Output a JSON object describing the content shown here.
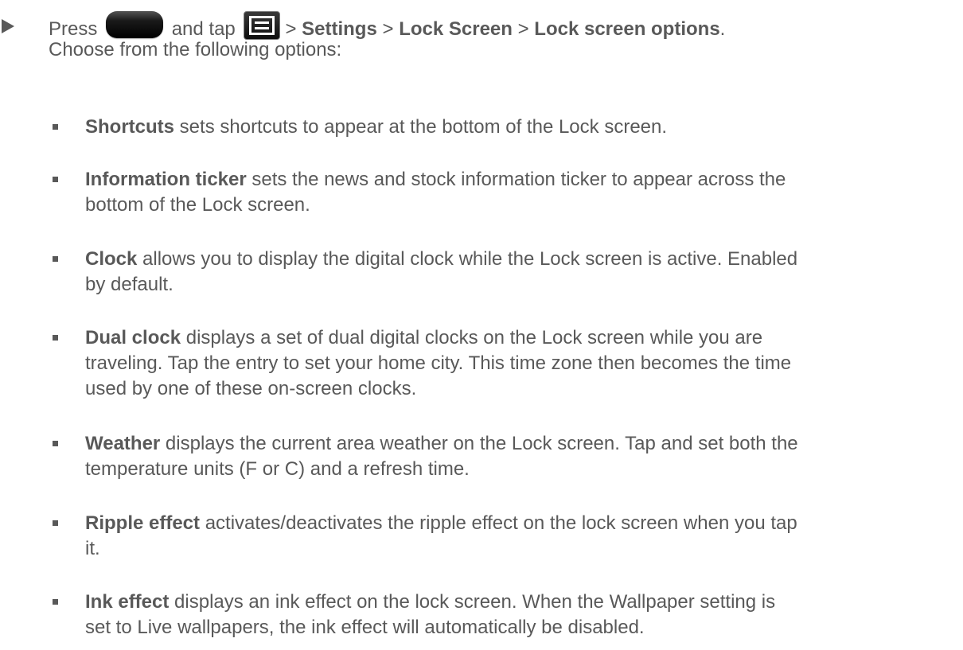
{
  "step": {
    "press_label": "Press",
    "and_tap_label": "and tap",
    "sep1": ">",
    "settings": "Settings",
    "sep2": ">",
    "lock_screen": "Lock Screen",
    "sep3": ">",
    "lock_screen_options": "Lock screen options",
    "period": ".",
    "subtext": "Choose from the following options:"
  },
  "icons": {
    "step_marker": "right-pointer-icon",
    "home_button": "home-button-icon",
    "menu_button": "menu-button-icon",
    "bullet": "square-bullet-icon"
  },
  "options": [
    {
      "term": "Shortcuts",
      "line1": " sets shortcuts to appear at the bottom of the Lock screen.",
      "line2": ""
    },
    {
      "term": "Information ticker",
      "line1": " sets the news and stock information ticker to appear across the",
      "line2": "bottom of the Lock screen."
    },
    {
      "term": "Clock",
      "line1": " allows you to display the digital clock while the Lock screen is active. Enabled",
      "line2": "by default."
    },
    {
      "term": "Dual clock",
      "line1": " displays a set of dual digital clocks on the Lock screen while you are",
      "line2": "traveling. Tap the entry to set your home city. This time zone then becomes the time",
      "line3": "used by one of these on-screen clocks."
    },
    {
      "term": "Weather",
      "line1": " displays the current area weather on the Lock screen. Tap and set both the",
      "line2": "temperature units (F or C) and a refresh time."
    },
    {
      "term": "Ripple effect",
      "line1": " activates/deactivates the ripple effect on the lock screen when you tap",
      "line2": "it."
    },
    {
      "term": "Ink effect",
      "line1": " displays an ink effect on the lock screen. When the Wallpaper setting is",
      "line2": "set to Live wallpapers, the ink effect will automatically be disabled."
    }
  ],
  "colors": {
    "text": "#595959",
    "background": "#ffffff"
  }
}
